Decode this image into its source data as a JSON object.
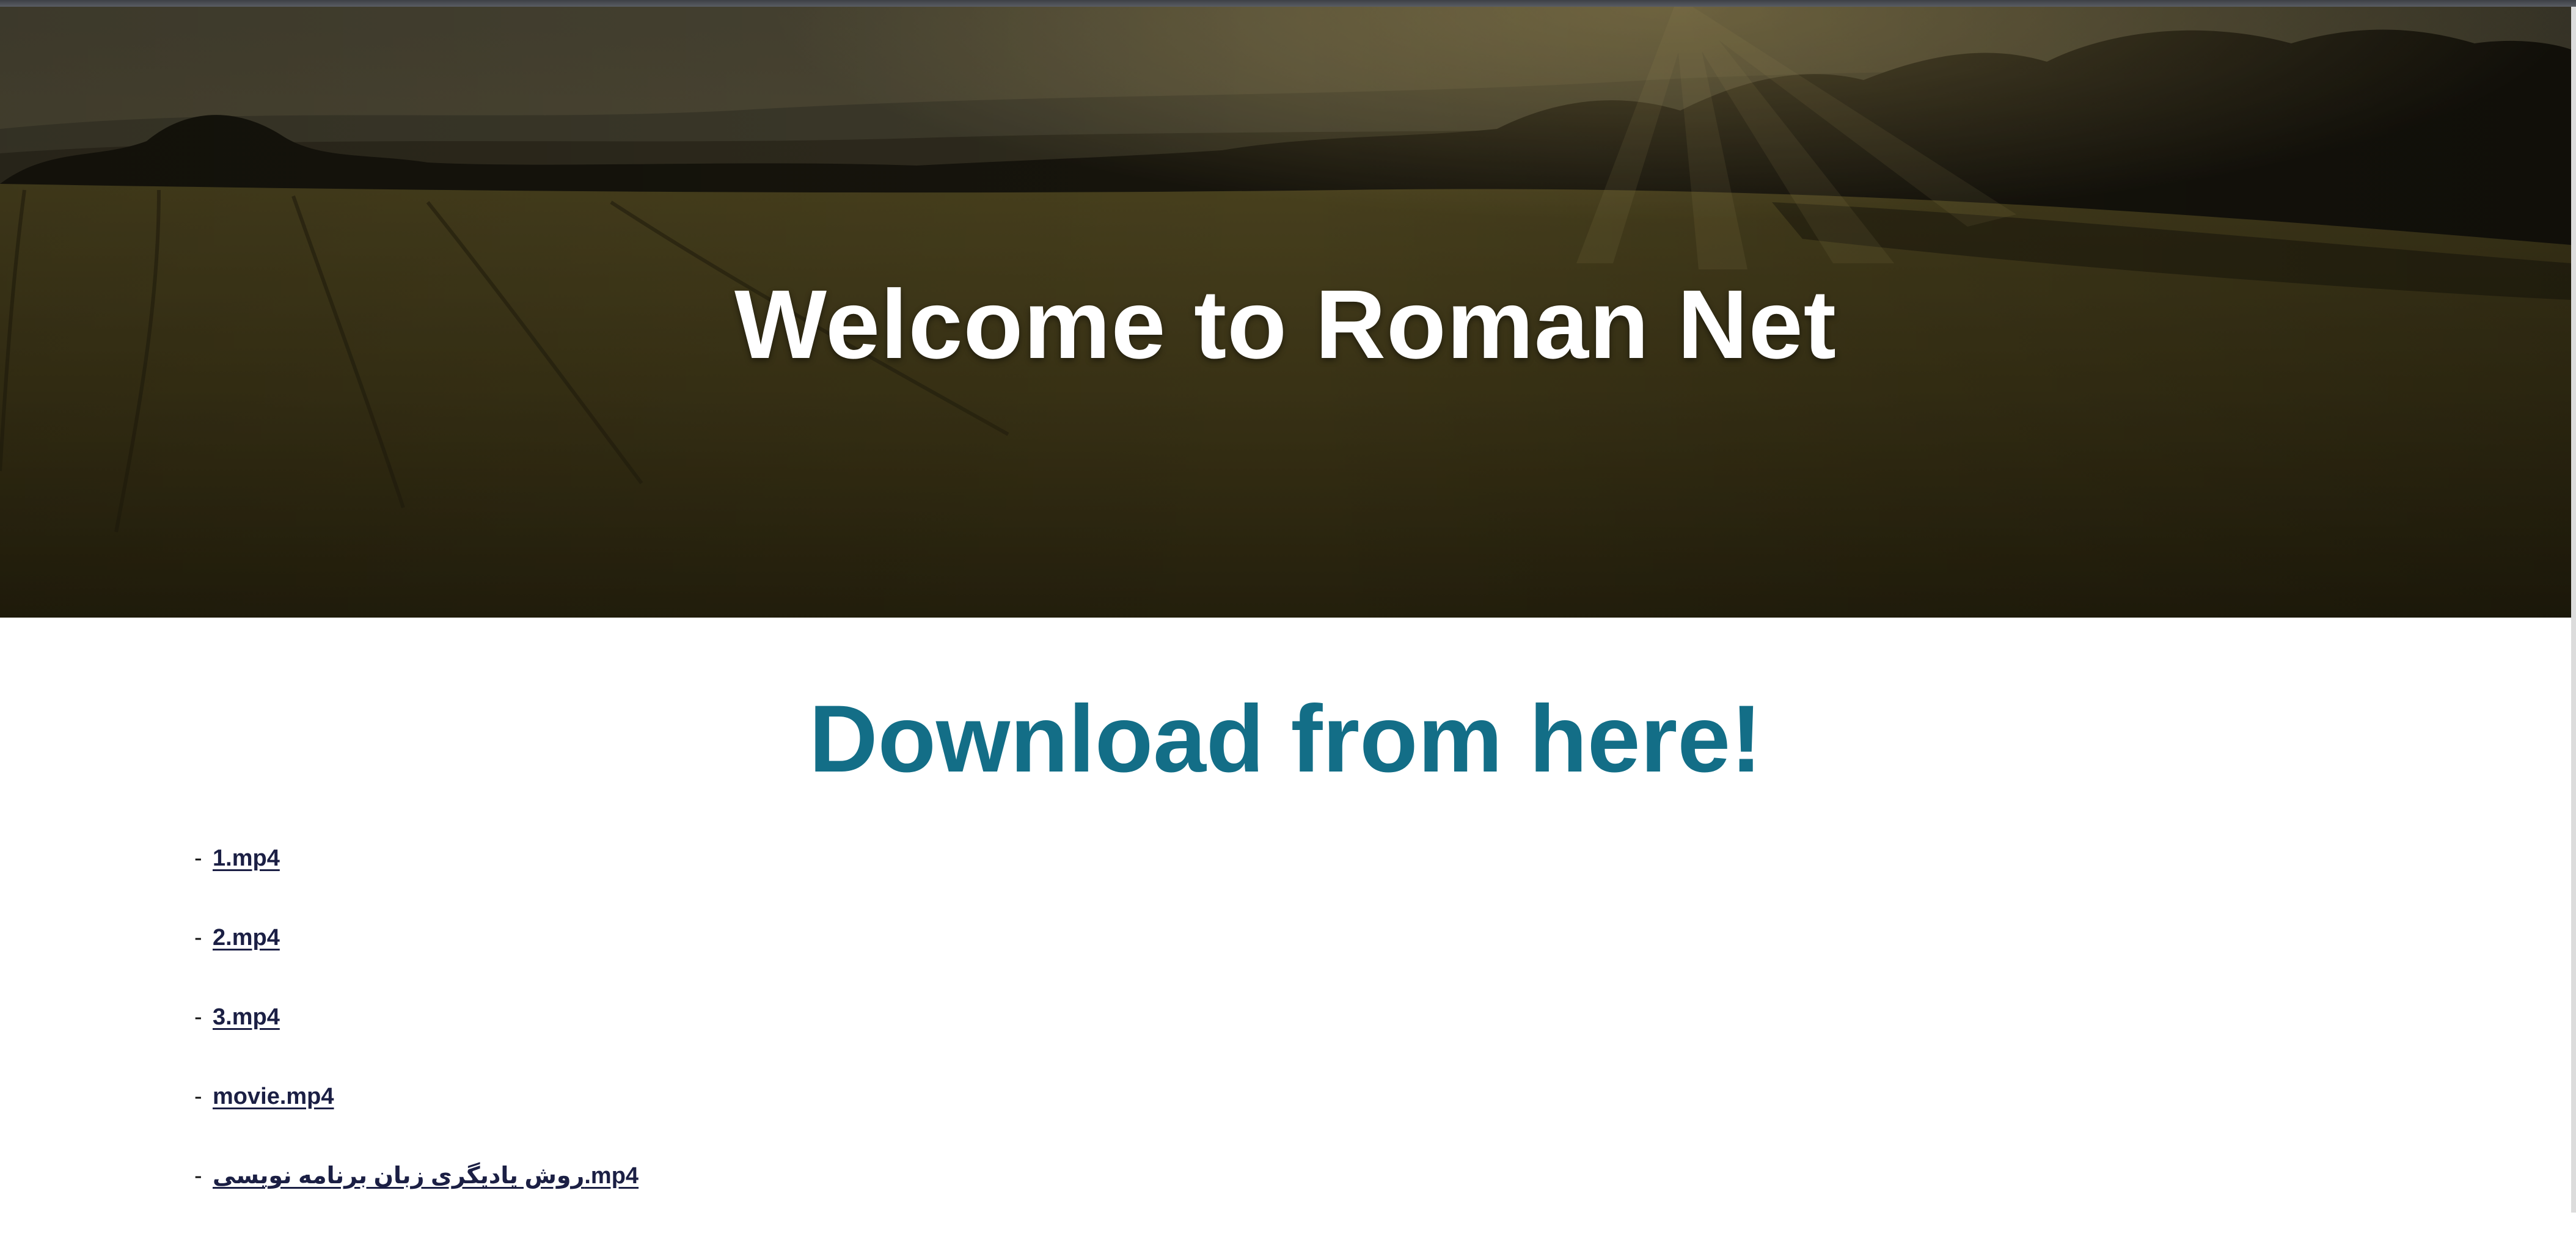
{
  "hero": {
    "title": "Welcome to Roman Net"
  },
  "main": {
    "heading": "Download from here!",
    "dash": "-",
    "files": [
      {
        "label": "1.mp4"
      },
      {
        "label": "2.mp4"
      },
      {
        "label": "3.mp4"
      },
      {
        "label": "movie.mp4"
      },
      {
        "label": "روش یادیگری زبان برنامه نویسی.mp4"
      }
    ]
  },
  "colors": {
    "heading": "#136e87",
    "link": "#1b1f44",
    "hero_title": "#ffffff"
  }
}
